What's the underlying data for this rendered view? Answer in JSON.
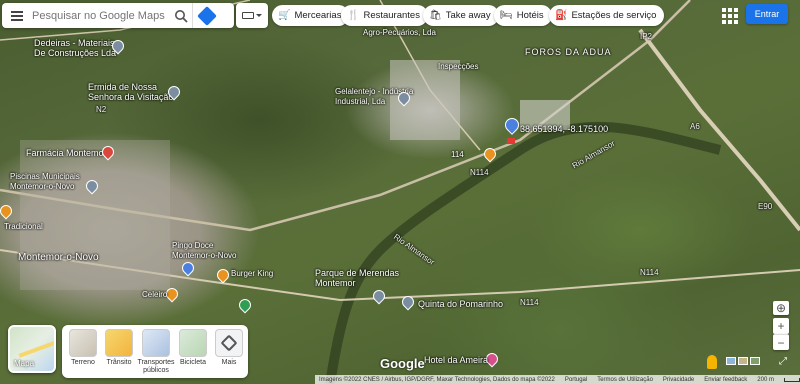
{
  "search": {
    "placeholder": "Pesquisar no Google Maps"
  },
  "chips": [
    {
      "label": "Mercearias",
      "icon": "cart-icon"
    },
    {
      "label": "Restaurantes",
      "icon": "utensils-icon"
    },
    {
      "label": "Take away",
      "icon": "bag-icon"
    },
    {
      "label": "Hotéis",
      "icon": "bed-icon"
    },
    {
      "label": "Estações de serviço",
      "icon": "fuel-icon"
    }
  ],
  "header": {
    "signin": "Entrar"
  },
  "map_labels": {
    "dedeiras": "Dedeiras - Materiais\nDe Construções Lda",
    "agro": "Agro-Pecuários, Lda",
    "inspecoes": "Inspecções",
    "foros": "FOROS DA ADUA",
    "ermida": "Ermida de Nossa\nSenhora da Visitação",
    "gelalentejo": "Gelalentejo - Indústria\nIndustrial, Lda",
    "coordinates": "38.651394, -8.175100",
    "farmacia": "Farmácia Montemor",
    "piscinas": "Piscinas Municipais\nMontemor-o-Novo",
    "tradicional": "Tradicional",
    "montemor": "Montemor-o-Novo",
    "burger_king": "Burger King",
    "celeiro": "Celeiro",
    "parque": "Parque de Merendas\nMontemor",
    "pingo_doce": "Pingo Doce\nMontemor-o-Novo",
    "quinta": "Quinta do Pomarinho",
    "hotel": "Hotel da Ameira",
    "rio1": "Rio Almansor",
    "rio2": "Rio Almansor",
    "n114": "N114",
    "n2": "N2",
    "a6": "A6",
    "road_114": "114",
    "n114_2": "N114",
    "n114_3": "N114",
    "ip2": "IP2",
    "e90": "E90"
  },
  "layers": {
    "main_label": "Mapa",
    "items": [
      {
        "label": "Terreno"
      },
      {
        "label": "Trânsito"
      },
      {
        "label": "Transportes\npúblicos"
      },
      {
        "label": "Bicicleta"
      },
      {
        "label": "Mais"
      }
    ]
  },
  "brand": "Google",
  "footer": {
    "imagery": "Imagens ©2022 CNES / Airbus, IGP/DGRF, Maxar Technologies, Dados do mapa ©2022",
    "portugal": "Portugal",
    "terms": "Termos de Utilização",
    "privacy": "Privacidade",
    "feedback": "Enviar feedback",
    "scale": "200 m"
  }
}
